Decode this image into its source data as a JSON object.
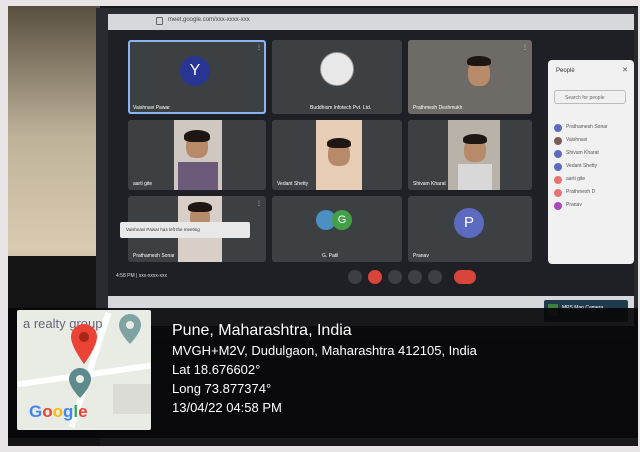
{
  "browser": {
    "url": "meet.google.com/xxx-xxxx-xxx"
  },
  "meeting": {
    "tiles": [
      {
        "name": "Vaishnavi Pawar",
        "avatar_letter": "Y",
        "avatar_color": "#283593"
      },
      {
        "name": "Buddhism Infotech Pvt. Ltd."
      },
      {
        "name": "Prathmesh Deshmukh"
      },
      {
        "name": "aarti gite"
      },
      {
        "name": "Vedant Shetty"
      },
      {
        "name": "Shivam Kharat"
      },
      {
        "name": "Prathamesh Sonar"
      },
      {
        "name": "G. Patil",
        "avatar_letter": "G"
      },
      {
        "name": "Pranav",
        "avatar_letter": "P",
        "avatar_color": "#5c6bc0"
      }
    ],
    "time_label": "4:58 PM | xxx-xxxx-xxx",
    "tooltip": "Vaishnavi Pawar has left the meeting",
    "people_panel": {
      "title": "People",
      "search_placeholder": "Search for people",
      "participants": [
        {
          "name": "Prathamesh Sonar",
          "color": "#5c6bc0"
        },
        {
          "name": "Vaishnavi",
          "color": "#7b5e57"
        },
        {
          "name": "Shivam Kharat",
          "color": "#5c6bc0"
        },
        {
          "name": "Vedant Shetty",
          "color": "#5c6bc0"
        },
        {
          "name": "aarti gite",
          "color": "#e57373"
        },
        {
          "name": "Prathmesh D",
          "color": "#e57373"
        },
        {
          "name": "Pranav",
          "color": "#ab47bc"
        }
      ]
    },
    "taskbar_item": "MPS Map Camera"
  },
  "geotag": {
    "map_label": "a realty group",
    "location": "Pune, Maharashtra, India",
    "address": "MVGH+M2V, Dudulgaon, Maharashtra 412105, India",
    "lat": "Lat 18.676602°",
    "long": "Long 73.877374°",
    "datetime": "13/04/22 04:58 PM",
    "map_brand": [
      "G",
      "o",
      "o",
      "g",
      "l",
      "e"
    ]
  }
}
